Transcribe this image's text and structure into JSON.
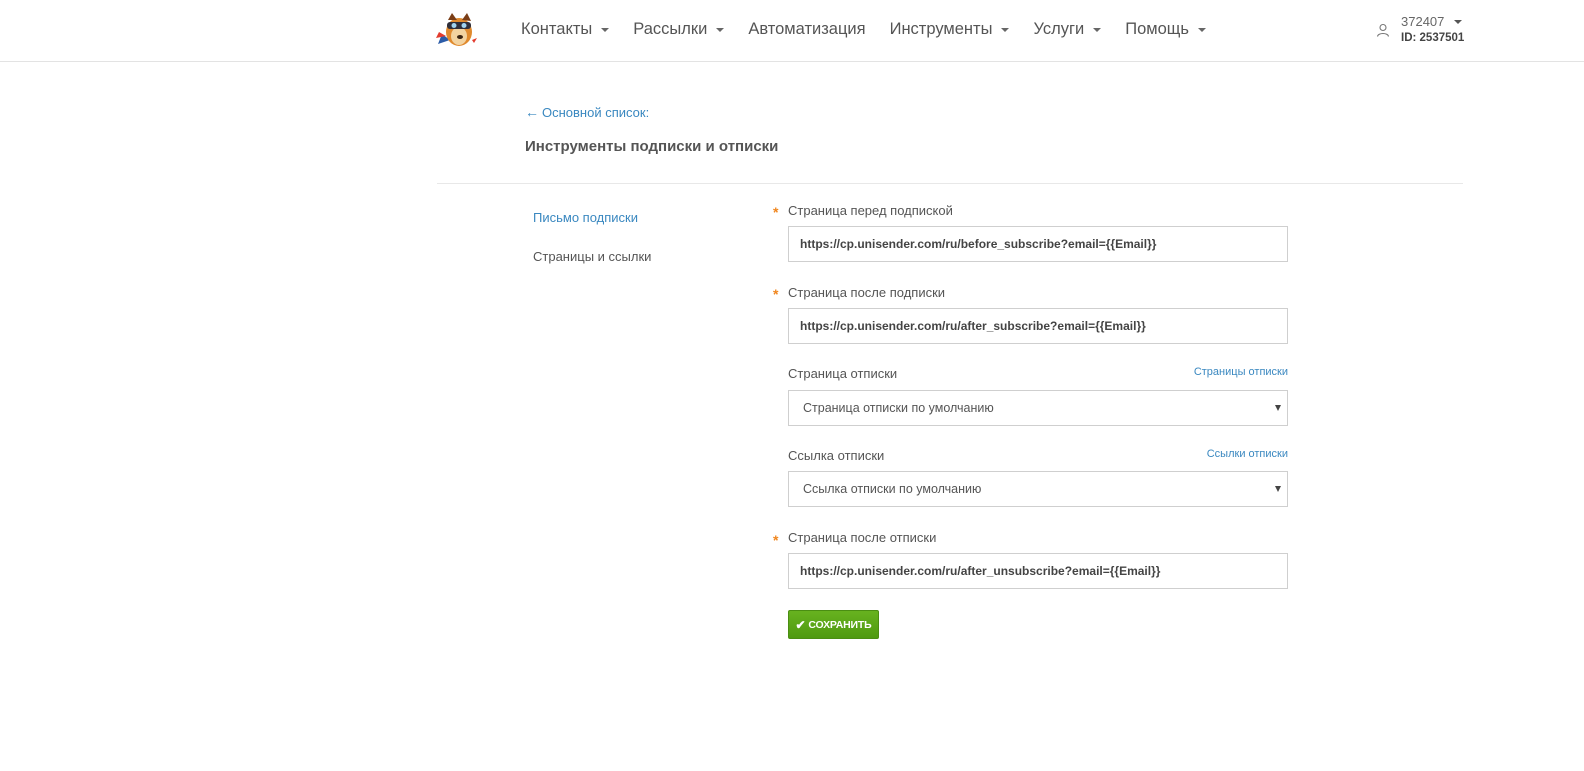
{
  "header": {
    "nav": [
      {
        "label": "Контакты",
        "has_dropdown": true
      },
      {
        "label": "Рассылки",
        "has_dropdown": true
      },
      {
        "label": "Автоматизация",
        "has_dropdown": false
      },
      {
        "label": "Инструменты",
        "has_dropdown": true
      },
      {
        "label": "Услуги",
        "has_dropdown": true
      },
      {
        "label": "Помощь",
        "has_dropdown": true
      }
    ],
    "account": {
      "login": "372407",
      "id": "ID: 2537501"
    }
  },
  "page": {
    "back_link": "Основной список:",
    "title": "Инструменты подписки и отписки"
  },
  "sidebar": {
    "items": [
      {
        "label": "Письмо подписки",
        "active": true
      },
      {
        "label": "Страницы и ссылки",
        "active": false
      }
    ]
  },
  "form": {
    "before_subscribe": {
      "label": "Страница перед подпиской",
      "value": "https://cp.unisender.com/ru/before_subscribe?email={{Email}}"
    },
    "after_subscribe": {
      "label": "Страница после подписки",
      "value": "https://cp.unisender.com/ru/after_subscribe?email={{Email}}"
    },
    "unsubscribe_page": {
      "label": "Страница отписки",
      "link": "Страницы отписки",
      "selected": "Страница отписки по умолчанию"
    },
    "unsubscribe_link": {
      "label": "Ссылка отписки",
      "link": "Ссылки отписки",
      "selected": "Ссылка отписки по умолчанию"
    },
    "after_unsubscribe": {
      "label": "Страница после отписки",
      "value": "https://cp.unisender.com/ru/after_unsubscribe?email={{Email}}"
    },
    "required_mark": "*",
    "save_label": "СОХРАНИТЬ"
  },
  "colors": {
    "link": "#3a88c0",
    "required": "#f0861e",
    "save_button": "#5aa617"
  },
  "icons": {
    "logo": "unisender-dog-logo-icon",
    "user": "user-icon",
    "back": "arrow-left-icon",
    "save": "check-icon"
  }
}
